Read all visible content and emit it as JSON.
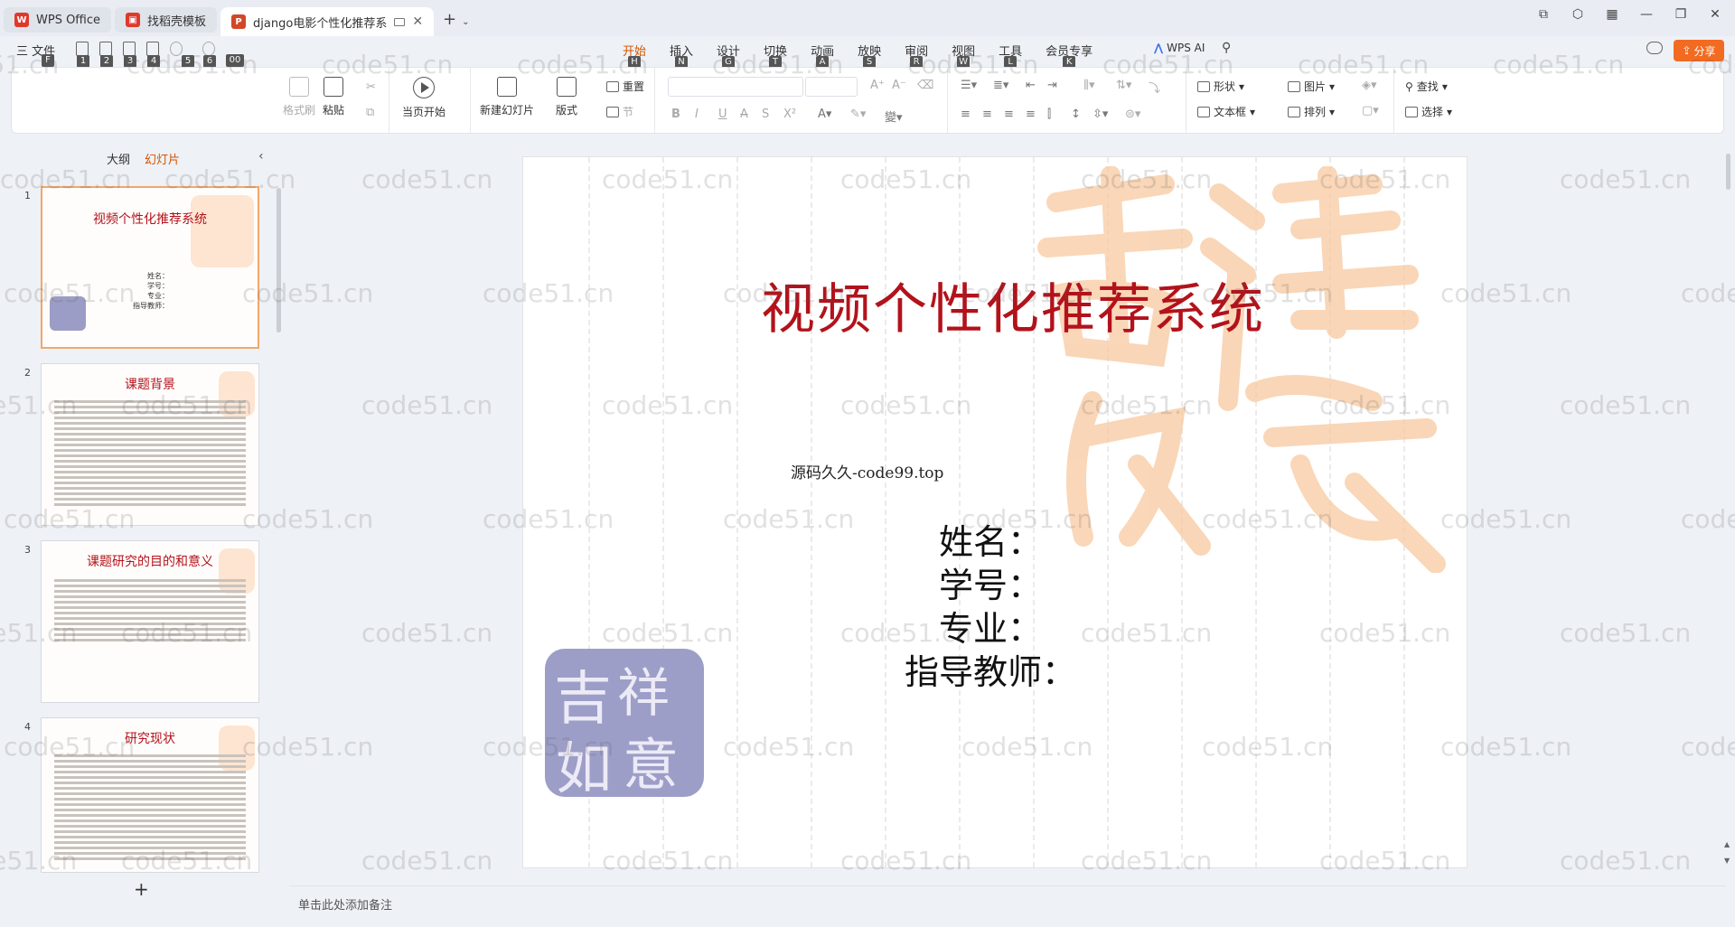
{
  "tabs": [
    {
      "label": "WPS Office",
      "logo": "W",
      "logo_color": "#e0392b"
    },
    {
      "label": "找稻壳模板",
      "logo": "▣",
      "logo_color": "#e0392b"
    },
    {
      "label": "django电影个性化推荐系统",
      "logo": "P",
      "logo_color": "#d24726"
    }
  ],
  "menu": {
    "file": "三 文件",
    "quick_access_keytips": [
      "F",
      "1",
      "2",
      "3",
      "4",
      "5",
      "6",
      "00"
    ],
    "ribbon_tabs": [
      {
        "label": "开始",
        "key": "H"
      },
      {
        "label": "插入",
        "key": "N"
      },
      {
        "label": "设计",
        "key": "G"
      },
      {
        "label": "切换",
        "key": "T"
      },
      {
        "label": "动画",
        "key": "A"
      },
      {
        "label": "放映",
        "key": "S"
      },
      {
        "label": "审阅",
        "key": "R"
      },
      {
        "label": "视图",
        "key": "W"
      },
      {
        "label": "工具",
        "key": "L"
      },
      {
        "label": "会员专享",
        "key": "K"
      }
    ],
    "wps_ai": "WPS AI",
    "share": "分享"
  },
  "ribbon": {
    "format_painter": "格式刷",
    "paste": "粘贴",
    "play_from_current": "当页开始",
    "new_slide": "新建幻灯片",
    "layout": "版式",
    "reset": "重置",
    "section": "节",
    "shapes": "形状",
    "picture": "图片",
    "textbox": "文本框",
    "arrange": "排列",
    "find": "查找",
    "select": "选择"
  },
  "left_panel": {
    "tab_outline": "大纲",
    "tab_slides": "幻灯片",
    "slides": [
      {
        "num": "1",
        "title": "视频个性化推荐系统",
        "fields": [
          "姓名：",
          "学号：",
          "专业：",
          "指导教师："
        ]
      },
      {
        "num": "2",
        "title": "课题背景"
      },
      {
        "num": "3",
        "title": "课题研究的目的和意义"
      },
      {
        "num": "4",
        "title": "研究现状"
      }
    ],
    "add_slide": "+"
  },
  "slide": {
    "title": "视频个性化推荐系统",
    "subtitle": "源码久久-code99.top",
    "fields": {
      "name": "姓名：",
      "student_id": "学号：",
      "major": "专业：",
      "advisor": "指导教师："
    },
    "seal_chars": [
      "吉",
      "祥",
      "如",
      "意"
    ]
  },
  "notes": {
    "placeholder": "单击此处添加备注"
  },
  "watermark": "code51.cn",
  "colors": {
    "accent": "#d35400",
    "title_red": "#b3121b",
    "share_orange": "#f26b21",
    "seal_purple": "#9c9ec8",
    "stamp_peach": "#f8c9a0"
  }
}
